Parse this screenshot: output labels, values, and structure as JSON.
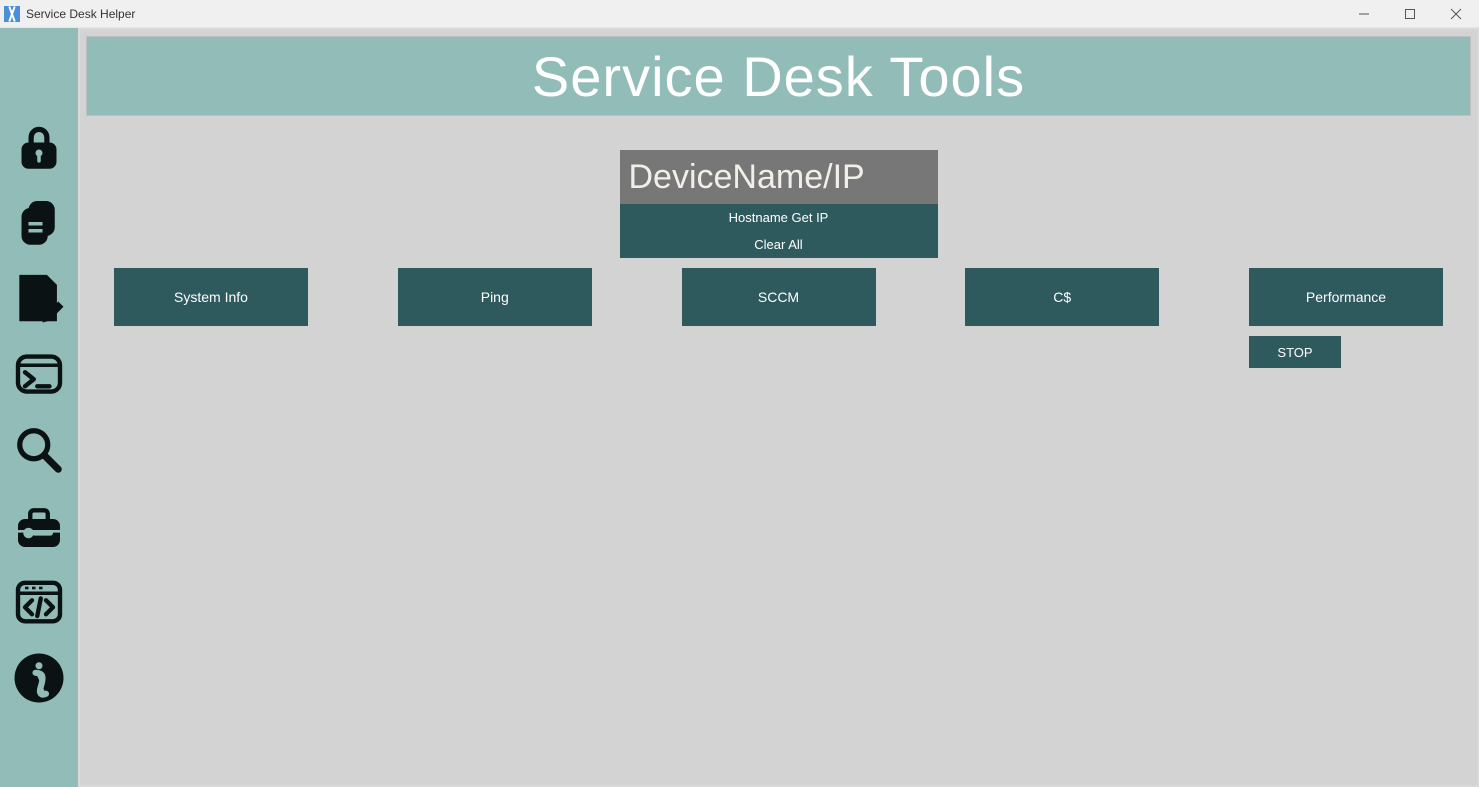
{
  "window": {
    "title": "Service Desk Helper"
  },
  "banner": {
    "title": "Service Desk Tools"
  },
  "input": {
    "placeholder": "DeviceName/IP",
    "value": ""
  },
  "sub_buttons": {
    "hostname": "Hostname Get IP",
    "clear": "Clear All"
  },
  "actions": {
    "system_info": "System Info",
    "ping": "Ping",
    "sccm": "SCCM",
    "cshare": "C$",
    "performance": "Performance",
    "stop": "STOP"
  },
  "sidebar": {
    "items": [
      {
        "name": "lock"
      },
      {
        "name": "clipboard"
      },
      {
        "name": "edit-document"
      },
      {
        "name": "terminal"
      },
      {
        "name": "search"
      },
      {
        "name": "toolbox"
      },
      {
        "name": "code-window"
      },
      {
        "name": "info"
      }
    ]
  }
}
